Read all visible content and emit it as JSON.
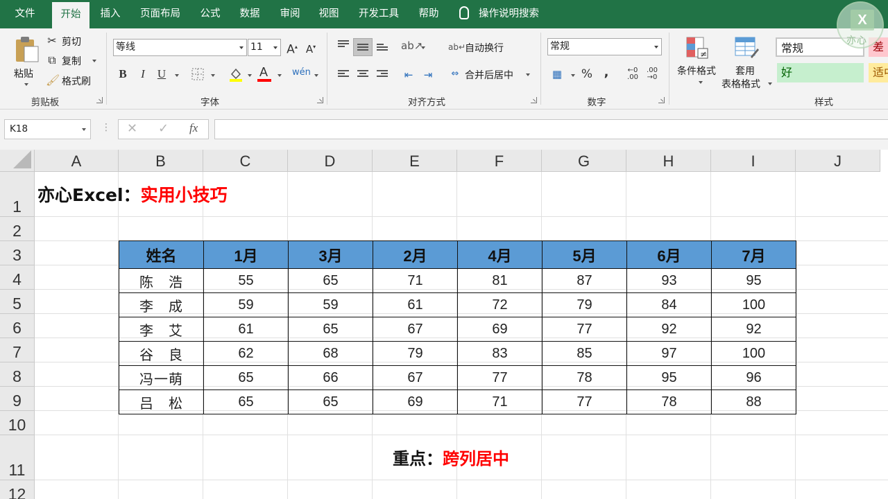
{
  "menu": {
    "tabs": [
      "文件",
      "开始",
      "插入",
      "页面布局",
      "公式",
      "数据",
      "审阅",
      "视图",
      "开发工具",
      "帮助"
    ],
    "active_tab": "开始",
    "tell_me": "操作说明搜索"
  },
  "logo": {
    "letters": "X",
    "text": "亦心"
  },
  "ribbon": {
    "clipboard": {
      "paste": "粘贴",
      "cut": "剪切",
      "copy": "复制",
      "format_painter": "格式刷",
      "label": "剪贴板"
    },
    "font": {
      "font_name": "等线",
      "font_size": "11",
      "bold": "B",
      "italic": "I",
      "underline": "U",
      "label": "字体"
    },
    "alignment": {
      "wrap_text": "自动换行",
      "merge_center": "合并后居中",
      "label": "对齐方式"
    },
    "number": {
      "format": "常规",
      "percent": "%",
      "comma": ",",
      "label": "数字"
    },
    "styles": {
      "conditional_formatting": "条件格式",
      "format_as_table_1": "套用",
      "format_as_table_2": "表格格式",
      "normal": "常规",
      "bad": "差",
      "good": "好",
      "neutral": "适中",
      "label": "样式"
    }
  },
  "formula_bar": {
    "name_box": "K18",
    "fx": "fx",
    "formula": ""
  },
  "sheet": {
    "columns": [
      "A",
      "B",
      "C",
      "D",
      "E",
      "F",
      "G",
      "H",
      "I",
      "J"
    ],
    "rows": [
      "1",
      "2",
      "3",
      "4",
      "5",
      "6",
      "7",
      "8",
      "9",
      "10",
      "11",
      "12"
    ],
    "title_prefix": "亦心Excel：",
    "title_red": "实用小技巧",
    "table_headers": [
      "姓名",
      "1月",
      "3月",
      "2月",
      "4月",
      "5月",
      "6月",
      "7月"
    ],
    "table_rows": [
      [
        "陈　浩",
        "55",
        "65",
        "71",
        "81",
        "87",
        "93",
        "95"
      ],
      [
        "李　成",
        "59",
        "59",
        "61",
        "72",
        "79",
        "84",
        "100"
      ],
      [
        "李　艾",
        "61",
        "65",
        "67",
        "69",
        "77",
        "92",
        "92"
      ],
      [
        "谷　良",
        "62",
        "68",
        "79",
        "83",
        "85",
        "97",
        "100"
      ],
      [
        "冯一萌",
        "65",
        "66",
        "67",
        "77",
        "78",
        "95",
        "96"
      ],
      [
        "吕　松",
        "65",
        "65",
        "69",
        "71",
        "77",
        "78",
        "88"
      ]
    ],
    "note_prefix": "重点：",
    "note_red": "跨列居中",
    "header_fill": "#5b9bd5"
  },
  "colors": {
    "excel_green": "#217346",
    "accent_red": "#ff0000"
  }
}
